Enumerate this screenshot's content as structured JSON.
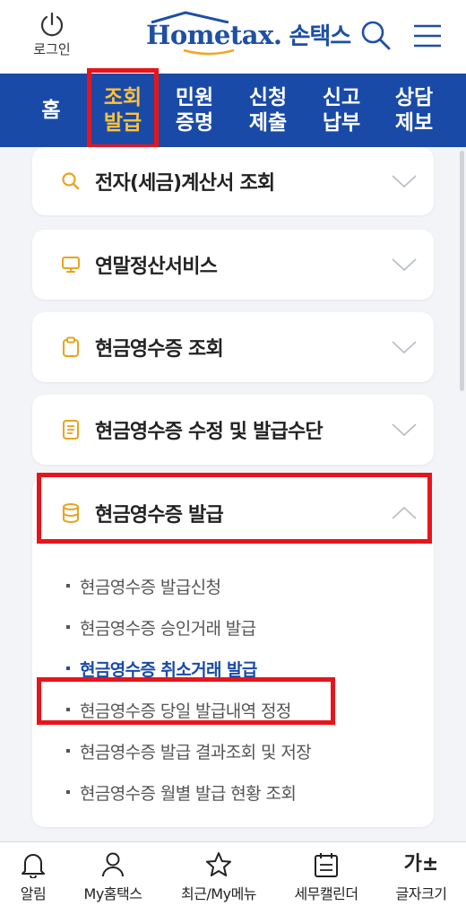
{
  "header": {
    "login_label": "로그인",
    "logo_en": "Hometax.",
    "logo_ko": "손택스"
  },
  "nav": {
    "items": [
      {
        "line1": "홈",
        "line2": ""
      },
      {
        "line1": "조회",
        "line2": "발급",
        "active": true
      },
      {
        "line1": "민원",
        "line2": "증명"
      },
      {
        "line1": "신청",
        "line2": "제출"
      },
      {
        "line1": "신고",
        "line2": "납부"
      },
      {
        "line1": "상담",
        "line2": "제보"
      }
    ]
  },
  "accordion": [
    {
      "title": "전자(세금)계산서 조회",
      "icon": "search-icon",
      "expanded": false
    },
    {
      "title": "연말정산서비스",
      "icon": "monitor-icon",
      "expanded": false
    },
    {
      "title": "현금영수증 조회",
      "icon": "clipboard-icon",
      "expanded": false
    },
    {
      "title": "현금영수증 수정 및 발급수단",
      "icon": "document-icon",
      "expanded": false
    },
    {
      "title": "현금영수증 발급",
      "icon": "database-icon",
      "expanded": true,
      "items": [
        "현금영수증 발급신청",
        "현금영수증 승인거래 발급",
        "현금영수증 취소거래 발급",
        "현금영수증 당일 발급내역 정정",
        "현금영수증 발급 결과조회 및 저장",
        "현금영수증 월별 발급 현황 조회"
      ],
      "current_item_index": 2
    }
  ],
  "bottom_bar": {
    "items": [
      {
        "label": "알림",
        "icon": "bell-icon"
      },
      {
        "label": "My홈택스",
        "icon": "person-icon"
      },
      {
        "label": "최근/My메뉴",
        "icon": "star-icon"
      },
      {
        "label": "세무캘린더",
        "icon": "calendar-icon"
      },
      {
        "label": "글자크기",
        "icon": "font-size-icon",
        "glyph": "가±"
      }
    ]
  },
  "colors": {
    "nav_bg": "#1a4aa8",
    "nav_active": "#ffc23a",
    "icon_accent": "#e8a41e",
    "highlight": "#e8141b",
    "current_link": "#1a4aa8"
  }
}
